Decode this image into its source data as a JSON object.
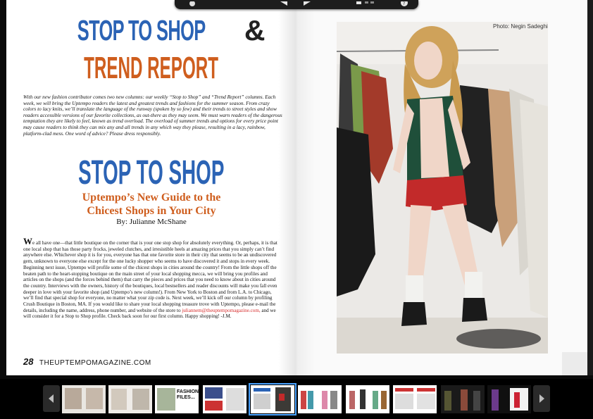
{
  "spread": {
    "left_page": {
      "title_blue": "STOP TO SHOP",
      "title_amp": "&",
      "title_orange": "TREND REPORT",
      "intro": "With our new fashion contributor comes two new columns: our weekly “Stop to Shop” and “Trend Report” columns. Each week, we will bring the Uptempo readers the latest and greatest trends and fashions for the summer season. From crazy colors to lacy knits, we’ll translate the language of the runway (spoken by so few) and their trends to street styles and show readers accessible versions of our favorite collections, as out-there as they may seem. We must warn readers of the dangerous temptation they are likely to feel, known as trend overload. The overload of summer trends and options for every price point may cause readers to think they can mix any and all trends in any which way they please, resulting in a lacy, rainbow, platform-clad mess. One word of advice? Please dress responsibly.",
      "section_title": "STOP TO SHOP",
      "subtitle_line1": "Uptempo’s New Guide to the",
      "subtitle_line2": "Chicest Shops in Your City",
      "byline": "By: Julianne McShane",
      "body_dropcap": "W",
      "body_part1": "e all have one—that little boutique on the corner that is your one stop shop for absolutely everything. Or, perhaps, it is that one local shop that has those party frocks, jeweled clutches, and irresistible heels at amazing prices that you simply can’t find anywhere else. Whichever shop it is for you, everyone has that one favorite store in their city that seems to be an undiscovered gem, unknown to everyone else except for the one lucky shopper who seems to have discovered it and stops in every week. Beginning next issue, Uptempo will profile some of the chicest shops in cities around the country! From the little shops off the beaten path to the heart-stopping boutique on the main street of your local shopping mecca, we will bring you profiles and articles on the shops (and the forces behind them) that carry the pieces and prices that you need to know about in cities around the country. Interviews with the owners, history of the boutiques, local bestsellers and reader discounts will make you fall even deeper in love with your favorite shop (and Uptempo’s new column!). From New York to Boston and from L.A. to Chicago, we’ll find that special shop for everyone, no matter what your zip code is. Next week, we’ll kick off our column by profiling Crush Boutique in Boston, MA. If you would like to share your local shopping treasure trove with Uptempo, please e-mail the details, including the name, address, phone number, and website of the store to ",
      "body_email": "juliannem@theuptempomagazine.com,",
      "body_part2": " and we will consider it for a Stop to Shop profile. Check back soon for our first column. Happy shopping! -J.M.",
      "page_number": "28",
      "site": "THEUPTEMPOMAGAZINE.COM"
    },
    "right_page": {
      "photo_credit": "Photo: Negin Sadeghi"
    }
  },
  "toolbar": {
    "icons": [
      "back-icon",
      "prev-page-icon",
      "next-page-icon",
      "grid-view-icon",
      "help-icon"
    ]
  },
  "thumbnails": {
    "label_fashion": "FASHION FILES...",
    "items": [
      {
        "name": "thumb-1"
      },
      {
        "name": "thumb-2"
      },
      {
        "name": "thumb-3"
      },
      {
        "name": "thumb-4"
      },
      {
        "name": "thumb-5",
        "active": true
      },
      {
        "name": "thumb-6"
      },
      {
        "name": "thumb-7"
      },
      {
        "name": "thumb-8"
      },
      {
        "name": "thumb-9"
      },
      {
        "name": "thumb-10"
      }
    ]
  },
  "colors": {
    "accent_blue": "#2b63b5",
    "accent_orange": "#cf5e1e",
    "email_red": "#d62b2b",
    "active_thumb": "#4aa3ff"
  }
}
